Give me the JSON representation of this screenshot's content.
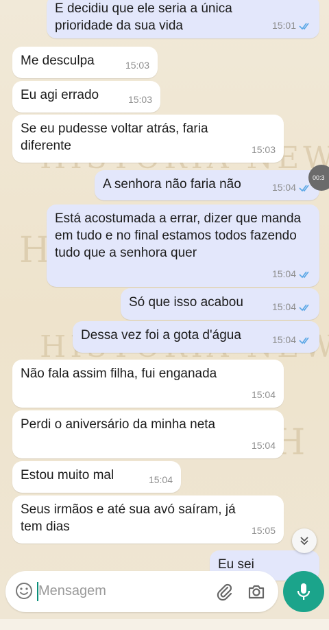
{
  "wallpaper": {
    "watermark_text": "HISTÓRIA NEWS SH",
    "watermark_letter": "H"
  },
  "messages": [
    {
      "direction": "out",
      "text": "E decidiu que ele seria a única prioridade da sua vida",
      "time": "15:01",
      "read": true
    },
    {
      "direction": "in",
      "text": "Me desculpa",
      "time": "15:03"
    },
    {
      "direction": "in",
      "text": "Eu agi errado",
      "time": "15:03"
    },
    {
      "direction": "in",
      "text": "Se eu pudesse voltar atrás, faria diferente",
      "time": "15:03"
    },
    {
      "direction": "out",
      "text": "A senhora não faria não",
      "time": "15:04",
      "read": true
    },
    {
      "direction": "out",
      "text": "Está acostumada a errar, dizer que manda em tudo e no final estamos todos fazendo tudo que a senhora quer",
      "time": "15:04",
      "read": true
    },
    {
      "direction": "out",
      "text": "Só que isso acabou",
      "time": "15:04",
      "read": true
    },
    {
      "direction": "out",
      "text": "Dessa vez foi a gota d'água",
      "time": "15:04",
      "read": true
    },
    {
      "direction": "in",
      "text": "Não fala assim filha, fui enganada",
      "time": "15:04"
    },
    {
      "direction": "in",
      "text": "Perdi o aniversário da minha neta",
      "time": "15:04"
    },
    {
      "direction": "in",
      "text": "Estou muito mal",
      "time": "15:04"
    },
    {
      "direction": "in",
      "text": "Seus irmãos e até sua avó saíram, já tem dias",
      "time": "15:05"
    },
    {
      "direction": "out",
      "text": "Eu sei",
      "time": ""
    }
  ],
  "overlay": {
    "duration_badge": "00:3"
  },
  "composer": {
    "placeholder": "Mensagem",
    "emoji_icon": "emoji-icon",
    "attach_icon": "paperclip-icon",
    "camera_icon": "camera-icon",
    "mic_icon": "microphone-icon"
  },
  "colors": {
    "outgoing_bubble": "#e3e7fb",
    "incoming_bubble": "#ffffff",
    "read_ticks": "#5aa7e6",
    "mic_button": "#1ba48b"
  }
}
